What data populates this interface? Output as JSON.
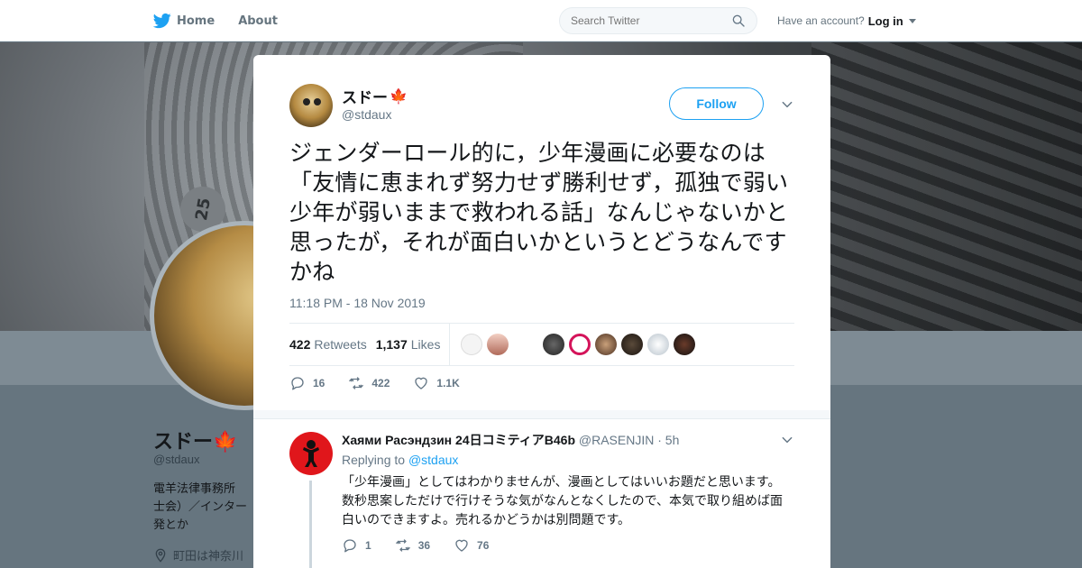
{
  "nav": {
    "home_label": "Home",
    "about_label": "About",
    "search_placeholder": "Search Twitter",
    "account_prompt": "Have an account?",
    "login_label": "Log in"
  },
  "background_profile": {
    "name": "スドー🍁",
    "handle": "@stdaux",
    "bio_lines": [
      "電羊法律事務所",
      "士会）／インター",
      "発とか"
    ],
    "location": "町田は神奈川",
    "plate_number": "25"
  },
  "tweet": {
    "name": "スドー",
    "name_emoji": "🍁",
    "handle": "@stdaux",
    "follow_label": "Follow",
    "text": "ジェンダーロール的に，少年漫画に必要なのは「友情に恵まれず努力せず勝利せず，孤独で弱い少年が弱いままで救われる話」なんじゃないかと思ったが，それが面白いかというとどうなんですかね",
    "timestamp": "11:18 PM - 18 Nov 2019",
    "retweets_count": "422",
    "retweets_label": "Retweets",
    "likes_count": "1,137",
    "likes_label": "Likes",
    "reply_count": "16",
    "retweet_action_count": "422",
    "like_action_count": "1.1K"
  },
  "reply": {
    "name": "Хаями Расэндзин 24日コミティアB46b",
    "handle": "@RASENJIN",
    "time": "5h",
    "replying_prefix": "Replying to",
    "replying_to": "@stdaux",
    "text_line1": "「少年漫画」としてはわかりませんが、漫画としてはいいお題だと思います。",
    "text_line2": "数秒思案しただけで行けそうな気がなんとなくしたので、本気で取り組めば面",
    "text_line3": "白いのできますよ。売れるかどうかは別問題です。",
    "reply_count": "1",
    "retweet_count": "36",
    "like_count": "76"
  },
  "colors": {
    "accent": "#1da1f2",
    "maple": "#d0021b",
    "overlay": "#66757f"
  }
}
